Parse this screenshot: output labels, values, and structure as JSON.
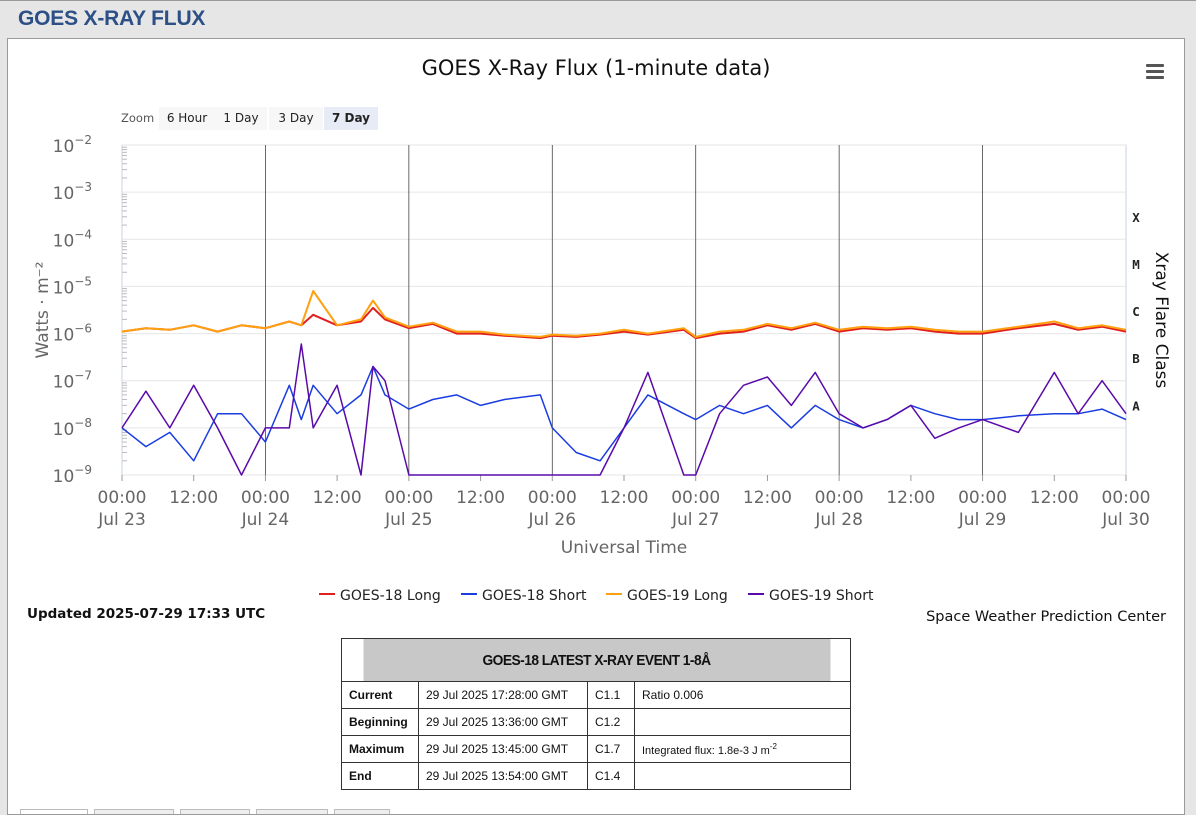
{
  "page": {
    "title": "GOES X-RAY FLUX"
  },
  "toolbar": {
    "menu_icon": "hamburger-menu-icon"
  },
  "zoom": {
    "label": "Zoom",
    "options": [
      "6 Hour",
      "1 Day",
      "3 Day",
      "7 Day"
    ],
    "active": "7 Day"
  },
  "footer": {
    "updated": "Updated 2025-07-29 17:33 UTC",
    "credit": "Space Weather Prediction Center"
  },
  "event_table": {
    "header": "GOES-18 LATEST X-RAY EVENT 1-8Å",
    "rows": [
      {
        "label": "Current",
        "time": "29 Jul 2025 17:28:00 GMT",
        "class": "C1.1",
        "note": "Ratio 0.006"
      },
      {
        "label": "Beginning",
        "time": "29 Jul 2025 13:36:00 GMT",
        "class": "C1.2",
        "note": ""
      },
      {
        "label": "Maximum",
        "time": "29 Jul 2025 13:45:00 GMT",
        "class": "C1.7",
        "note": "Integrated flux: 1.8e-3 J m",
        "note_sup": "-2"
      },
      {
        "label": "End",
        "time": "29 Jul 2025 13:54:00 GMT",
        "class": "C1.4",
        "note": ""
      }
    ]
  },
  "chart_data": {
    "type": "line",
    "title": "GOES X-Ray Flux (1-minute data)",
    "xlabel": "Universal Time",
    "ylabel": "Watts · m⁻²",
    "y2label": "Xray Flare Class",
    "y_scale": "log",
    "ylim": [
      1e-09,
      0.01
    ],
    "xlim": [
      "2025-07-23 00:00",
      "2025-07-30 00:00"
    ],
    "y_ticks": [
      {
        "base": "10",
        "exp": "−9"
      },
      {
        "base": "10",
        "exp": "−8"
      },
      {
        "base": "10",
        "exp": "−7"
      },
      {
        "base": "10",
        "exp": "−6"
      },
      {
        "base": "10",
        "exp": "−5"
      },
      {
        "base": "10",
        "exp": "−4"
      },
      {
        "base": "10",
        "exp": "−3"
      },
      {
        "base": "10",
        "exp": "−2"
      }
    ],
    "flare_classes": [
      {
        "label": "A",
        "value": 1e-08
      },
      {
        "label": "B",
        "value": 1e-07
      },
      {
        "label": "C",
        "value": 1e-06
      },
      {
        "label": "M",
        "value": 1e-05
      },
      {
        "label": "X",
        "value": 0.0001
      }
    ],
    "x_ticks": [
      {
        "time": "00:00",
        "date": "Jul 23"
      },
      {
        "time": "12:00",
        "date": ""
      },
      {
        "time": "00:00",
        "date": "Jul 24"
      },
      {
        "time": "12:00",
        "date": ""
      },
      {
        "time": "00:00",
        "date": "Jul 25"
      },
      {
        "time": "12:00",
        "date": ""
      },
      {
        "time": "00:00",
        "date": "Jul 26"
      },
      {
        "time": "12:00",
        "date": ""
      },
      {
        "time": "00:00",
        "date": "Jul 27"
      },
      {
        "time": "12:00",
        "date": ""
      },
      {
        "time": "00:00",
        "date": "Jul 28"
      },
      {
        "time": "12:00",
        "date": ""
      },
      {
        "time": "00:00",
        "date": "Jul 29"
      },
      {
        "time": "12:00",
        "date": ""
      },
      {
        "time": "00:00",
        "date": "Jul 30"
      }
    ],
    "grid": true,
    "legend_position": "bottom-center",
    "series": [
      {
        "name": "GOES-18 Long",
        "color": "#e0201e",
        "x_hours": [
          0,
          4,
          8,
          12,
          16,
          20,
          24,
          28,
          30,
          32,
          36,
          40,
          42,
          44,
          48,
          52,
          56,
          60,
          64,
          70,
          72,
          76,
          80,
          84,
          88,
          94,
          96,
          100,
          104,
          108,
          112,
          116,
          120,
          124,
          128,
          132,
          136,
          140,
          144,
          150,
          156,
          160,
          164,
          168
        ],
        "values": [
          1.1e-06,
          1.3e-06,
          1.2e-06,
          1.5e-06,
          1.1e-06,
          1.5e-06,
          1.3e-06,
          1.8e-06,
          1.5e-06,
          2.5e-06,
          1.5e-06,
          1.8e-06,
          3.5e-06,
          2e-06,
          1.3e-06,
          1.6e-06,
          1e-06,
          1e-06,
          9e-07,
          8e-07,
          9e-07,
          8.5e-07,
          9.5e-07,
          1.1e-06,
          9.5e-07,
          1.2e-06,
          8e-07,
          1e-06,
          1.1e-06,
          1.5e-06,
          1.2e-06,
          1.6e-06,
          1.1e-06,
          1.3e-06,
          1.2e-06,
          1.3e-06,
          1.1e-06,
          1e-06,
          1e-06,
          1.3e-06,
          1.6e-06,
          1.2e-06,
          1.4e-06,
          1.1e-06
        ]
      },
      {
        "name": "GOES-18 Short",
        "color": "#1a3de0",
        "x_hours": [
          0,
          4,
          8,
          12,
          16,
          20,
          24,
          28,
          30,
          32,
          36,
          40,
          42,
          44,
          48,
          52,
          56,
          60,
          64,
          70,
          72,
          76,
          80,
          84,
          88,
          94,
          96,
          100,
          104,
          108,
          112,
          116,
          120,
          124,
          128,
          132,
          136,
          140,
          144,
          150,
          156,
          160,
          164,
          168
        ],
        "values": [
          1e-08,
          4e-09,
          8e-09,
          2e-09,
          2e-08,
          2e-08,
          5e-09,
          8e-08,
          1.5e-08,
          8e-08,
          2e-08,
          5e-08,
          2e-07,
          5e-08,
          2.5e-08,
          4e-08,
          5e-08,
          3e-08,
          4e-08,
          5e-08,
          1e-08,
          3e-09,
          2e-09,
          1e-08,
          5e-08,
          2e-08,
          1.5e-08,
          3e-08,
          2e-08,
          3e-08,
          1e-08,
          3e-08,
          1.5e-08,
          1e-08,
          1.5e-08,
          3e-08,
          2e-08,
          1.5e-08,
          1.5e-08,
          1.8e-08,
          2e-08,
          2e-08,
          2.5e-08,
          1.5e-08
        ]
      },
      {
        "name": "GOES-19 Long",
        "color": "#ffa010",
        "x_hours": [
          0,
          4,
          8,
          12,
          16,
          20,
          24,
          28,
          30,
          32,
          36,
          40,
          42,
          44,
          48,
          52,
          56,
          60,
          64,
          70,
          72,
          76,
          80,
          84,
          88,
          94,
          96,
          100,
          104,
          108,
          112,
          116,
          120,
          124,
          128,
          132,
          136,
          140,
          144,
          150,
          156,
          160,
          164,
          168
        ],
        "values": [
          1.1e-06,
          1.3e-06,
          1.2e-06,
          1.5e-06,
          1.1e-06,
          1.5e-06,
          1.3e-06,
          1.8e-06,
          1.5e-06,
          8e-06,
          1.5e-06,
          2e-06,
          5e-06,
          2.2e-06,
          1.4e-06,
          1.7e-06,
          1.1e-06,
          1.1e-06,
          9.5e-07,
          8.5e-07,
          9.5e-07,
          9e-07,
          1e-06,
          1.2e-06,
          1e-06,
          1.3e-06,
          8.5e-07,
          1.1e-06,
          1.2e-06,
          1.6e-06,
          1.3e-06,
          1.7e-06,
          1.2e-06,
          1.4e-06,
          1.3e-06,
          1.4e-06,
          1.2e-06,
          1.1e-06,
          1.1e-06,
          1.4e-06,
          1.8e-06,
          1.3e-06,
          1.5e-06,
          1.2e-06
        ]
      },
      {
        "name": "GOES-19 Short",
        "color": "#5a0aaa",
        "x_hours": [
          0,
          4,
          8,
          12,
          16,
          20,
          24,
          28,
          30,
          32,
          36,
          40,
          42,
          44,
          48,
          52,
          56,
          60,
          64,
          70,
          72,
          76,
          80,
          84,
          88,
          94,
          96,
          100,
          104,
          108,
          112,
          116,
          120,
          124,
          128,
          132,
          136,
          140,
          144,
          150,
          156,
          160,
          164,
          168
        ],
        "values": [
          1e-08,
          6e-08,
          1e-08,
          8e-08,
          1e-08,
          1e-09,
          1e-08,
          1e-08,
          6e-07,
          1e-08,
          8e-08,
          1e-09,
          2e-07,
          1e-07,
          1e-09,
          1e-09,
          1e-09,
          1e-09,
          1e-09,
          1e-09,
          1e-09,
          1e-09,
          1e-09,
          1e-08,
          1.5e-07,
          1e-09,
          1e-09,
          2e-08,
          8e-08,
          1.2e-07,
          3e-08,
          1.5e-07,
          2e-08,
          1e-08,
          1.5e-08,
          3e-08,
          6e-09,
          1e-08,
          1.5e-08,
          8e-09,
          1.5e-07,
          2e-08,
          1e-07,
          2e-08
        ]
      }
    ]
  }
}
